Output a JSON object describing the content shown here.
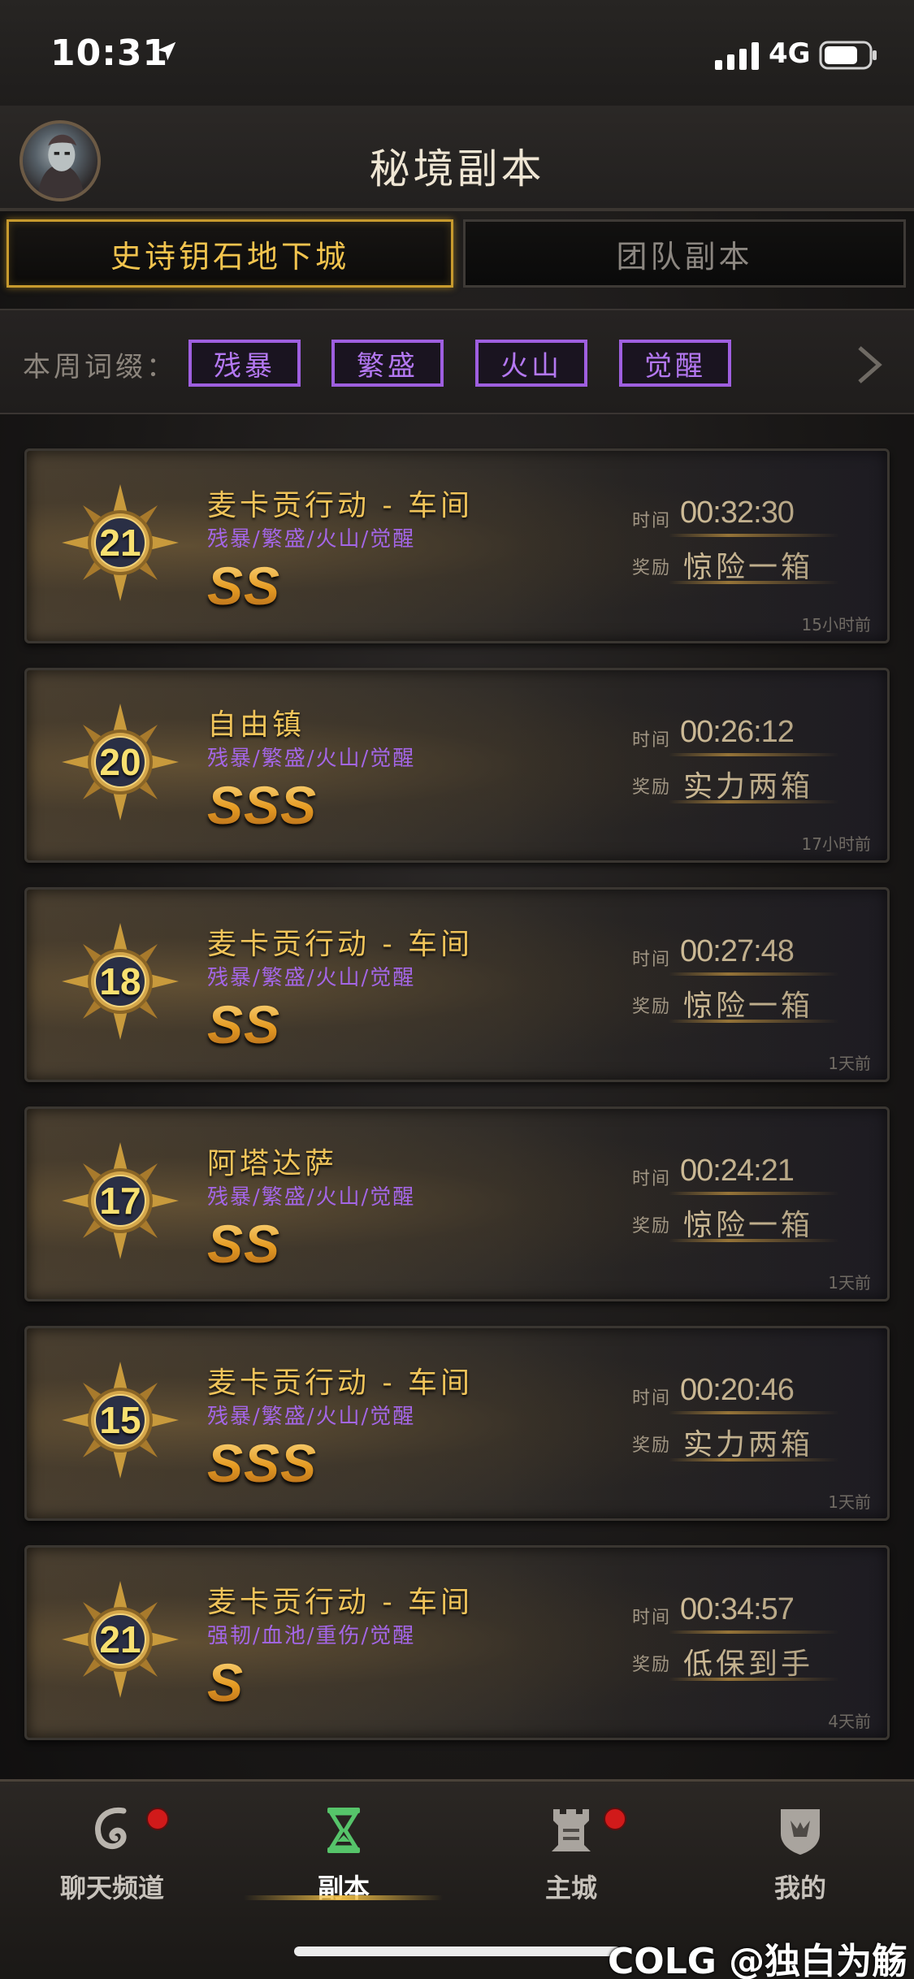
{
  "status_bar": {
    "time": "10:31",
    "network": "4G"
  },
  "header": {
    "title": "秘境副本"
  },
  "tabs": [
    {
      "label": "史诗钥石地下城",
      "active": true
    },
    {
      "label": "团队副本",
      "active": false
    }
  ],
  "affix_bar": {
    "label": "本周词缀：",
    "affixes": [
      "残暴",
      "繁盛",
      "火山",
      "觉醒"
    ]
  },
  "stat_labels": {
    "time": "时间",
    "reward": "奖励"
  },
  "runs": [
    {
      "level": "21",
      "name": "麦卡贡行动 - 车间",
      "affixes": "残暴/繁盛/火山/觉醒",
      "grade": "SS",
      "time": "00:32:30",
      "reward": "惊险一箱",
      "ago": "15小时前"
    },
    {
      "level": "20",
      "name": "自由镇",
      "affixes": "残暴/繁盛/火山/觉醒",
      "grade": "SSS",
      "time": "00:26:12",
      "reward": "实力两箱",
      "ago": "17小时前"
    },
    {
      "level": "18",
      "name": "麦卡贡行动 - 车间",
      "affixes": "残暴/繁盛/火山/觉醒",
      "grade": "SS",
      "time": "00:27:48",
      "reward": "惊险一箱",
      "ago": "1天前"
    },
    {
      "level": "17",
      "name": "阿塔达萨",
      "affixes": "残暴/繁盛/火山/觉醒",
      "grade": "SS",
      "time": "00:24:21",
      "reward": "惊险一箱",
      "ago": "1天前"
    },
    {
      "level": "15",
      "name": "麦卡贡行动 - 车间",
      "affixes": "残暴/繁盛/火山/觉醒",
      "grade": "SSS",
      "time": "00:20:46",
      "reward": "实力两箱",
      "ago": "1天前"
    },
    {
      "level": "21",
      "name": "麦卡贡行动 - 车间",
      "affixes": "强韧/血池/重伤/觉醒",
      "grade": "S",
      "time": "00:34:57",
      "reward": "低保到手",
      "ago": "4天前"
    }
  ],
  "bottom_nav": [
    {
      "label": "聊天频道",
      "icon": "chat-swirl-icon",
      "badge": true,
      "active": false
    },
    {
      "label": "副本",
      "icon": "hourglass-icon",
      "badge": false,
      "active": true
    },
    {
      "label": "主城",
      "icon": "castle-tower-icon",
      "badge": true,
      "active": false
    },
    {
      "label": "我的",
      "icon": "shield-crest-icon",
      "badge": false,
      "active": false
    }
  ],
  "watermark": "COLG @独白为觞",
  "colors": {
    "gold": "#f0c45a",
    "affix_purple": "#a466e6",
    "badge_red": "#d11a1a",
    "active_green": "#56c46a"
  }
}
